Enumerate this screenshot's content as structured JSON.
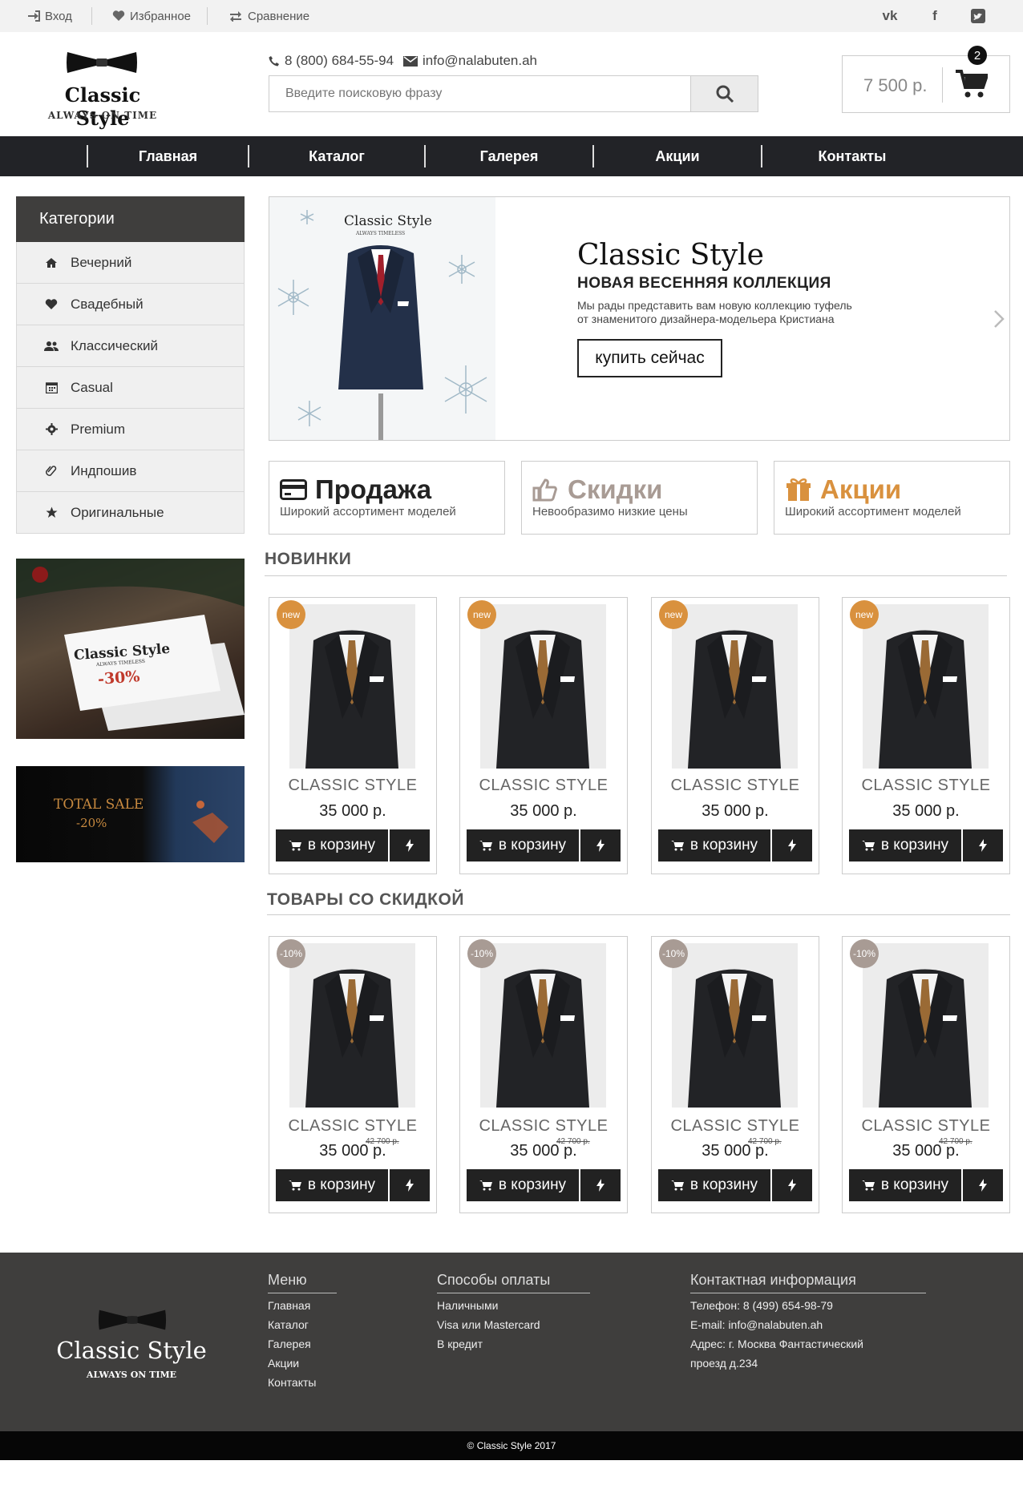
{
  "topbar": {
    "login": "Вход",
    "favorites": "Избранное",
    "compare": "Сравнение",
    "social": [
      "vk-icon",
      "facebook-icon",
      "twitter-icon"
    ]
  },
  "header": {
    "logo_title": "Classic Style",
    "logo_tagline": "ALWAYS ON TIME",
    "phone": "8 (800) 684-55-94",
    "email": "info@nalabuten.ah",
    "search_placeholder": "Введите поисковую фразу",
    "cart_total": "7 500 р.",
    "cart_count": "2"
  },
  "nav": [
    "Главная",
    "Каталог",
    "Галерея",
    "Акции",
    "Контакты"
  ],
  "sidebar": {
    "title": "Категории",
    "items": [
      {
        "label": "Вечерний",
        "icon": "home-icon"
      },
      {
        "label": "Свадебный",
        "icon": "heart-icon"
      },
      {
        "label": "Классический",
        "icon": "users-icon"
      },
      {
        "label": "Casual",
        "icon": "calendar-icon"
      },
      {
        "label": "Premium",
        "icon": "gear-icon"
      },
      {
        "label": "Индпошив",
        "icon": "paperclip-icon"
      },
      {
        "label": "Оригинальные",
        "icon": "star-icon"
      }
    ],
    "promo1": {
      "brand": "Classic Style",
      "tagline": "ALWAYS TIMELESS",
      "discount": "-30%"
    },
    "promo2": {
      "title": "TOTAL SALE",
      "discount": "-20%"
    }
  },
  "hero": {
    "image_brand": "Classic Style",
    "image_tagline": "ALWAYS TIMELESS",
    "title": "Classic Style",
    "subtitle": "НОВАЯ ВЕСЕННЯЯ КОЛЛЕКЦИЯ",
    "text1": "Мы рады представить вам новую коллекцию туфель",
    "text2": "от знаменитого дизайнера-модельера Кристиана",
    "button": "купить сейчас"
  },
  "features": [
    {
      "title": "Продажа",
      "subtitle": "Широкий ассортимент моделей",
      "icon": "credit-card-icon",
      "color": "#222222"
    },
    {
      "title": "Скидки",
      "subtitle": "Невообразимо низкие цены",
      "icon": "thumbs-up-icon",
      "color": "#a89b94"
    },
    {
      "title": "Акции",
      "subtitle": "Широкий ассортимент моделей",
      "icon": "gift-icon",
      "color": "#d9913e"
    }
  ],
  "sections": {
    "new": "НОВИНКИ",
    "sale": "ТОВАРЫ СО СКИДКОЙ"
  },
  "new_products": [
    {
      "tag": "new",
      "name": "CLASSIC STYLE",
      "price": "35 000 р."
    },
    {
      "tag": "new",
      "name": "CLASSIC STYLE",
      "price": "35 000 р."
    },
    {
      "tag": "new",
      "name": "CLASSIC STYLE",
      "price": "35 000 р."
    },
    {
      "tag": "new",
      "name": "CLASSIC STYLE",
      "price": "35 000 р."
    }
  ],
  "sale_products": [
    {
      "tag": "-10%",
      "name": "CLASSIC STYLE",
      "price": "35 000 р.",
      "old_price": "42 700 р."
    },
    {
      "tag": "-10%",
      "name": "CLASSIC STYLE",
      "price": "35 000 р.",
      "old_price": "42 700 р."
    },
    {
      "tag": "-10%",
      "name": "CLASSIC STYLE",
      "price": "35 000 р.",
      "old_price": "42 700 р."
    },
    {
      "tag": "-10%",
      "name": "CLASSIC STYLE",
      "price": "35 000 р.",
      "old_price": "42 700 р."
    }
  ],
  "buy_label": "в корзину",
  "colors": {
    "new_tag": "#d9913e",
    "sale_tag": "#a89b94",
    "dark": "#222222",
    "footer": "#3f3e3d"
  },
  "footer": {
    "logo_title": "Classic Style",
    "logo_tagline": "ALWAYS ON TIME",
    "menu_title": "Меню",
    "menu": [
      "Главная",
      "Каталог",
      "Галерея",
      "Акции",
      "Контакты"
    ],
    "pay_title": "Способы оплаты",
    "pay": [
      "Наличными",
      "Visa или Mastercard",
      "В кредит"
    ],
    "contact_title": "Контактная информация",
    "contacts": [
      "Телефон: 8 (499) 654-98-79",
      "E-mail: info@nalabuten.ah",
      "Адрес: г. Москва Фантастический",
      "проезд д.234"
    ],
    "copyright": "© Classic Style 2017"
  }
}
